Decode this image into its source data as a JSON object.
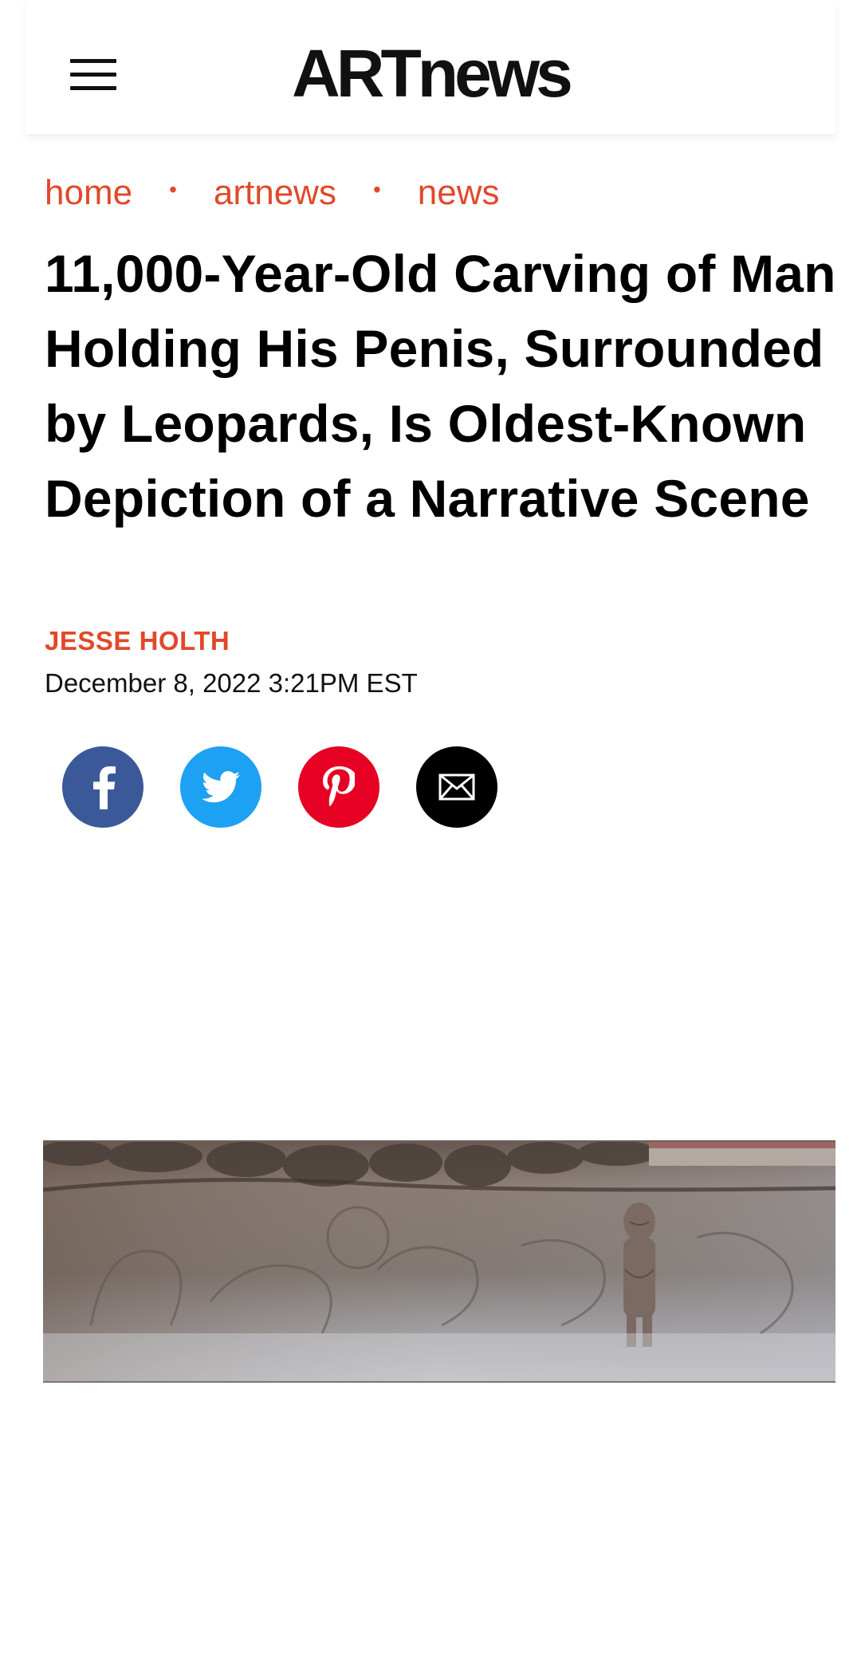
{
  "header": {
    "logo": "ARTnews"
  },
  "breadcrumb": {
    "items": [
      "home",
      "artnews",
      "news"
    ],
    "separator": "•"
  },
  "article": {
    "headline": "11,000-Year-Old Carving of Man Holding His Penis, Surrounded by Leopards, Is Oldest-Known Depiction of a Narrative Scene",
    "author": "JESSE HOLTH",
    "date": "December 8, 2022 3:21PM EST"
  },
  "share": [
    {
      "network": "facebook",
      "icon": "facebook-icon",
      "color": "#3b5998"
    },
    {
      "network": "twitter",
      "icon": "twitter-icon",
      "color": "#1da1f2"
    },
    {
      "network": "pinterest",
      "icon": "pinterest-icon",
      "color": "#e60023"
    },
    {
      "network": "email",
      "icon": "email-icon",
      "color": "#000000"
    }
  ],
  "colors": {
    "accent": "#e0492a",
    "text": "#111111"
  }
}
